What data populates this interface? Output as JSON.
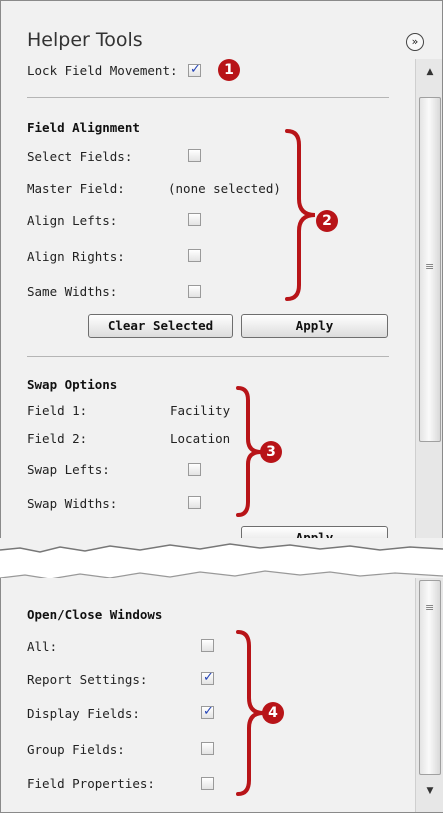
{
  "header": {
    "title": "Helper Tools"
  },
  "lock_field": {
    "label": "Lock Field Movement:",
    "checked": true
  },
  "field_alignment": {
    "title": "Field Alignment",
    "select_fields": {
      "label": "Select Fields:",
      "checked": false
    },
    "master_field": {
      "label": "Master Field:",
      "value": "(none selected)"
    },
    "align_lefts": {
      "label": "Align Lefts:",
      "checked": false
    },
    "align_rights": {
      "label": "Align Rights:",
      "checked": false
    },
    "same_widths": {
      "label": "Same Widths:",
      "checked": false
    },
    "clear_button": "Clear Selected",
    "apply_button": "Apply"
  },
  "swap_options": {
    "title": "Swap Options",
    "field1": {
      "label": "Field 1:",
      "value": "Facility"
    },
    "field2": {
      "label": "Field 2:",
      "value": "Location"
    },
    "swap_lefts": {
      "label": "Swap Lefts:",
      "checked": false
    },
    "swap_widths": {
      "label": "Swap Widths:",
      "checked": false
    },
    "apply_button": "Apply"
  },
  "open_close": {
    "title": "Open/Close Windows",
    "all": {
      "label": "All:",
      "checked": false
    },
    "report_settings": {
      "label": "Report Settings:",
      "checked": true
    },
    "display_fields": {
      "label": "Display Fields:",
      "checked": true
    },
    "group_fields": {
      "label": "Group Fields:",
      "checked": false
    },
    "field_properties": {
      "label": "Field Properties:",
      "checked": false
    }
  },
  "callouts": [
    "1",
    "2",
    "3",
    "4"
  ],
  "colors": {
    "callout": "#b81418",
    "check": "#2746b7",
    "panel": "#f1f1f1"
  },
  "icons": [
    "collapse-icon",
    "scroll-up-icon",
    "scroll-down-icon",
    "scroll-grip-icon",
    "checkmark-icon",
    "brace-icon"
  ]
}
